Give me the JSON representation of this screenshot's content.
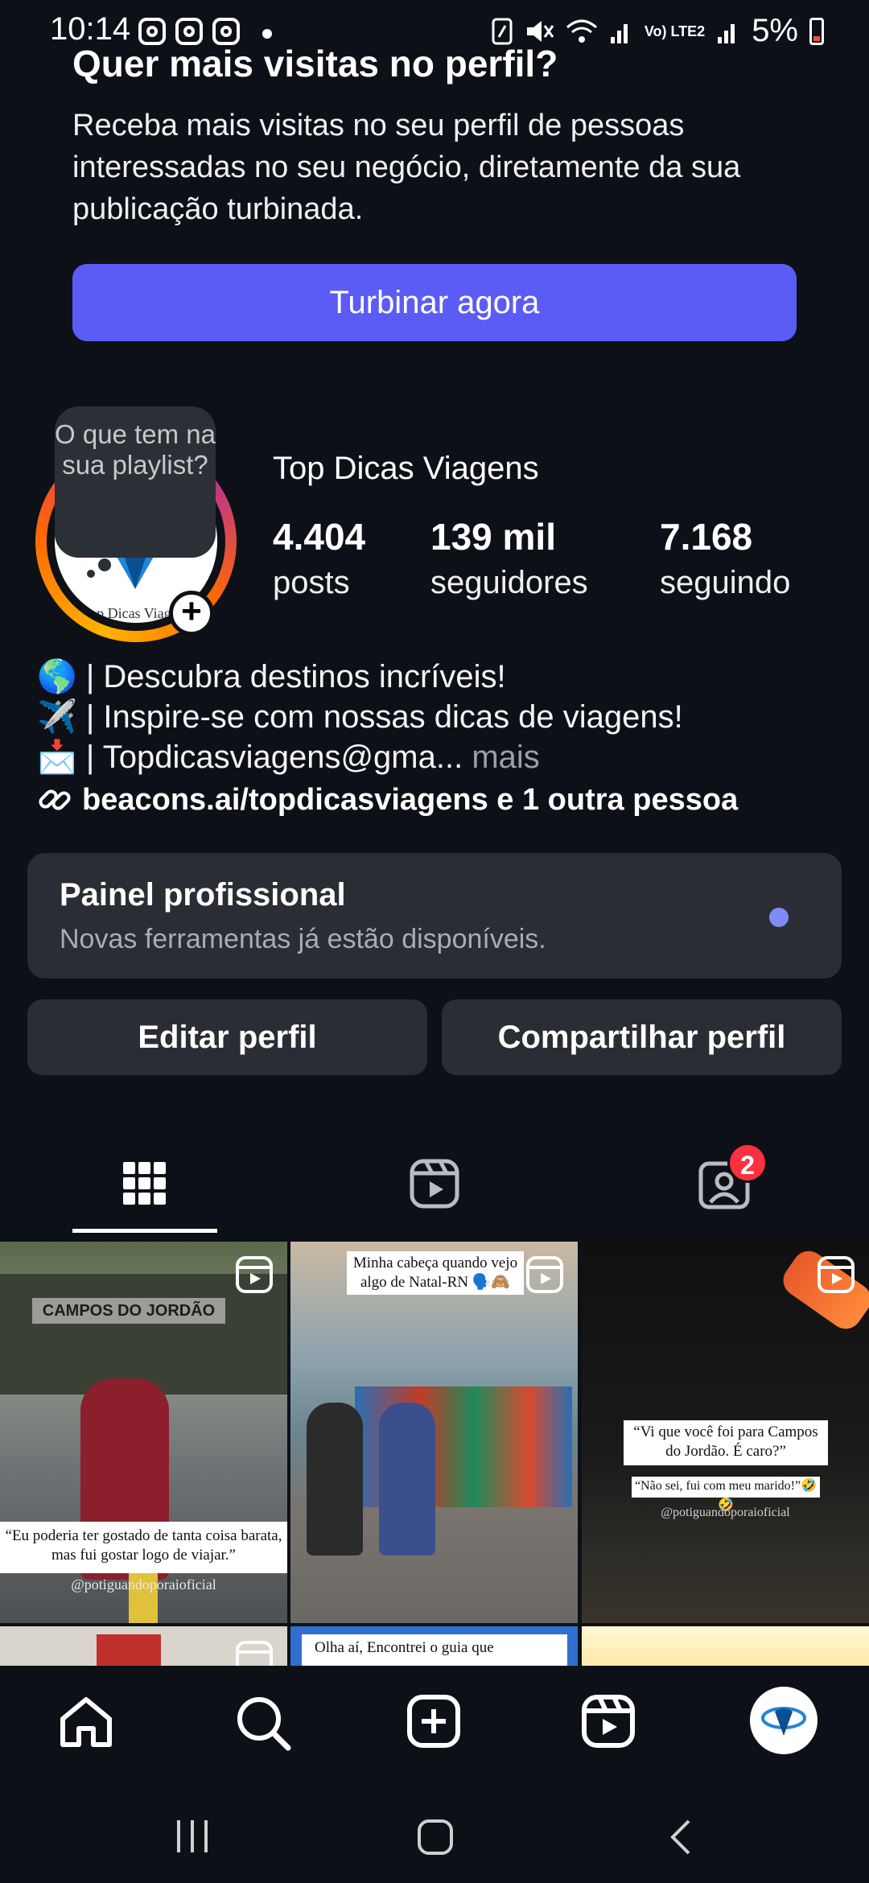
{
  "status_bar": {
    "time": "10:14",
    "battery": "5%",
    "network": "Vo) LTE2"
  },
  "promo": {
    "title": "Quer mais visitas no perfil?",
    "text": "Receba mais visitas no seu perfil de pessoas interessadas no seu negócio, diretamente da sua publicação turbinada.",
    "button": "Turbinar agora"
  },
  "profile": {
    "note_bubble": "O que tem na sua playlist?",
    "avatar_brand": "Top Dicas Viagens",
    "name": "Top Dicas Viagens",
    "stats": [
      {
        "value": "4.404",
        "label": "posts"
      },
      {
        "value": "139 mil",
        "label": "seguidores"
      },
      {
        "value": "7.168",
        "label": "seguindo"
      }
    ],
    "bio_lines": [
      "🌎 | Descubra destinos incríveis!",
      "✈️ | Inspire-se com nossas dicas de viagens!",
      "📩 | Topdicasviagens@gma..."
    ],
    "bio_more": " mais",
    "link": "beacons.ai/topdicasviagens e 1 outra pessoa"
  },
  "pro_dashboard": {
    "title": "Painel profissional",
    "subtitle": "Novas ferramentas já estão disponíveis."
  },
  "actions": {
    "edit": "Editar perfil",
    "share": "Compartilhar perfil"
  },
  "tabs": {
    "tagged_badge": "2"
  },
  "posts": [
    {
      "sign": "CAMPOS DO JORDÃO",
      "caption": "“Eu poderia ter gostado de tanta coisa barata, mas fui gostar logo de viajar.”",
      "handle": "@potiguandoporaioficial"
    },
    {
      "top_caption": "Minha cabeça quando vejo algo de Natal-RN 🗣️🙈"
    },
    {
      "caption1": "“Vi que você foi para Campos do Jordão. É caro?”",
      "caption2": "“Não sei, fui com meu marido!”🤣🤣",
      "handle": "@potiguandoporaioficial"
    },
    {
      "top_caption": "Olha aí, Encontrei o guia que"
    }
  ],
  "colors": {
    "background": "#0d1117",
    "accent": "#5b5cf5",
    "card": "#2a2d34",
    "badge": "#ff3040"
  }
}
